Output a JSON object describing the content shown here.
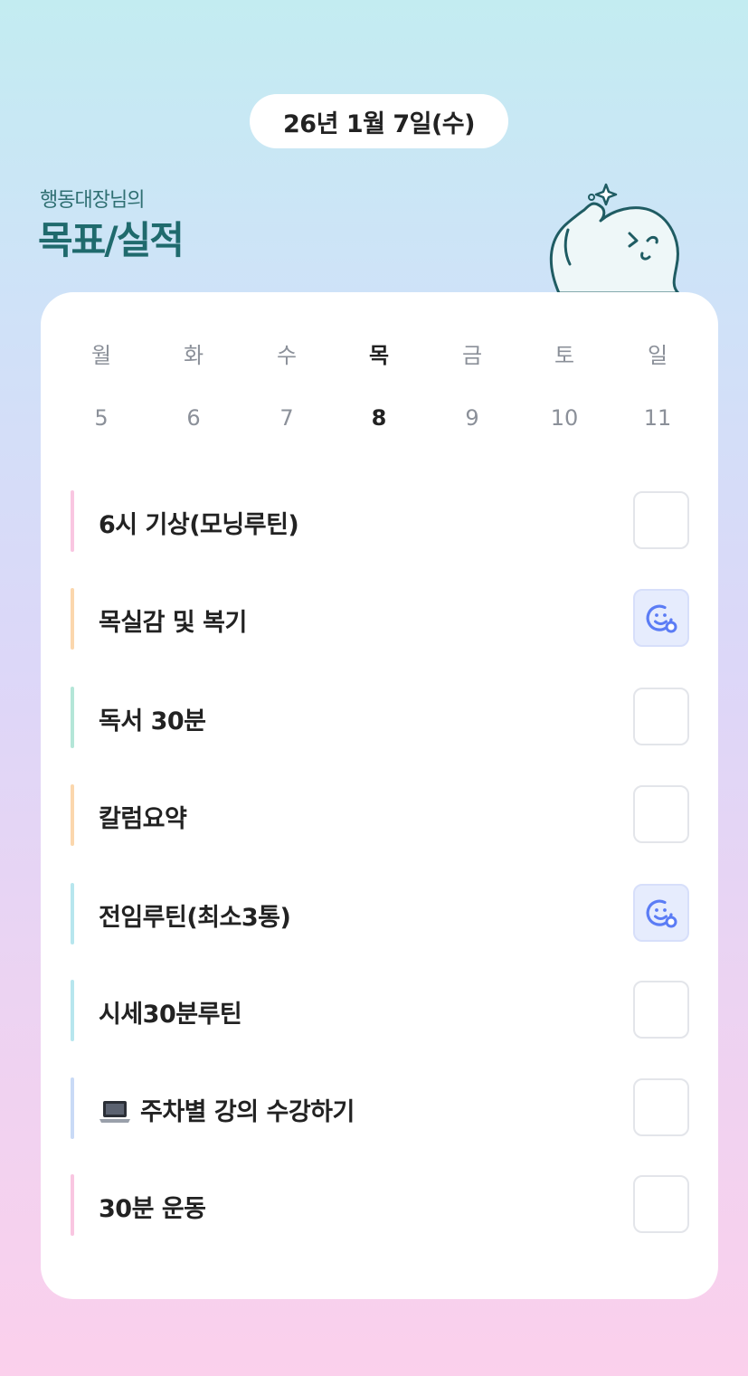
{
  "header": {
    "date": "26년 1월 7일(수)",
    "subtitle": "행동대장님의",
    "title": "목표/실적"
  },
  "week": {
    "days": [
      {
        "dow": "월",
        "num": "5"
      },
      {
        "dow": "화",
        "num": "6"
      },
      {
        "dow": "수",
        "num": "7"
      },
      {
        "dow": "목",
        "num": "8",
        "active": true
      },
      {
        "dow": "금",
        "num": "9"
      },
      {
        "dow": "토",
        "num": "10"
      },
      {
        "dow": "일",
        "num": "11"
      }
    ]
  },
  "tasks": [
    {
      "label": "6시 기상(모닝루틴)",
      "color": "#f9c6e1",
      "done": false
    },
    {
      "label": "목실감 및 복기",
      "color": "#fbd7ad",
      "done": true
    },
    {
      "label": "독서 30분",
      "color": "#b4e6d8",
      "done": false
    },
    {
      "label": "칼럼요약",
      "color": "#fbd7ad",
      "done": false
    },
    {
      "label": "전임루틴(최소3통)",
      "color": "#b7e6ee",
      "done": true
    },
    {
      "label": "시세30분루틴",
      "color": "#b7e6ee",
      "done": false
    },
    {
      "label": "주차별 강의 수강하기",
      "icon": "laptop-icon",
      "color": "#c9daf6",
      "done": false
    },
    {
      "label": "30분 운동",
      "color": "#f9c6e1",
      "done": false
    }
  ],
  "colors": {
    "accent": "#1f6a6d",
    "check_done_bg": "#e6ecfd",
    "check_done_icon": "#5b7cf5"
  }
}
